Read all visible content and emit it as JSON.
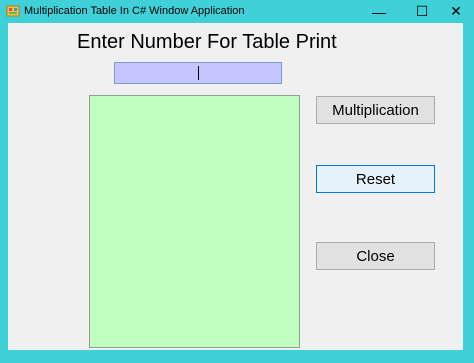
{
  "window": {
    "title": "Multiplication Table In C# Window Application",
    "controls": {
      "minimize": "—",
      "maximize": "☐",
      "close": "✕"
    }
  },
  "form": {
    "heading": "Enter Number For Table Print",
    "number_input": {
      "value": ""
    },
    "table_output": {
      "value": ""
    },
    "buttons": {
      "multiplication": "Multiplication",
      "reset": "Reset",
      "close": "Close"
    }
  },
  "colors": {
    "title_bar": "#3fd1d7",
    "input_bg": "#c5c5ff",
    "output_bg": "#c0fec0",
    "form_bg": "#f0f0f0"
  },
  "icons": {
    "app": "winforms-app-icon",
    "minimize": "minimize-icon",
    "maximize": "maximize-icon",
    "close": "close-icon"
  }
}
